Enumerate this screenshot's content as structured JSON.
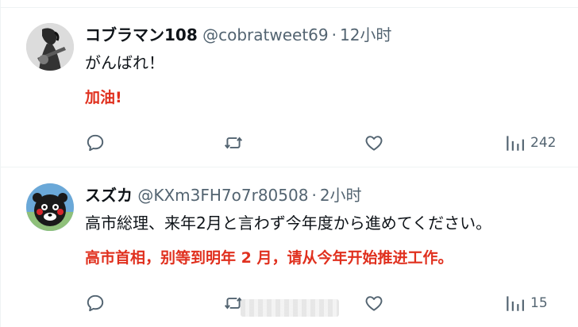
{
  "tweets": [
    {
      "name": "コブラマン108",
      "handle": "@cobratweet69",
      "separator": "·",
      "time": "12小时",
      "text": "がんばれ！",
      "translation": "加油!",
      "reply_icon": "reply-bubble-icon",
      "retweet_icon": "retweet-arrows-icon",
      "like_icon": "heart-icon",
      "views_icon": "views-bar-chart-icon",
      "views": "242"
    },
    {
      "name": "スズカ",
      "handle": "@KXm3FH7o7r80508",
      "separator": "·",
      "time": "2小时",
      "text": "高市総理、来年2月と言わず今年度から進めてください。",
      "translation": "高市首相，别等到明年 2 月，请从今年开始推进工作。",
      "reply_icon": "reply-bubble-icon",
      "retweet_icon": "retweet-arrows-icon",
      "like_icon": "heart-icon",
      "views_icon": "views-bar-chart-icon",
      "views": "15"
    }
  ],
  "colors": {
    "text": "#0f1419",
    "secondary": "#536471",
    "translation": "#e0301e",
    "divider": "#eff3f4"
  }
}
